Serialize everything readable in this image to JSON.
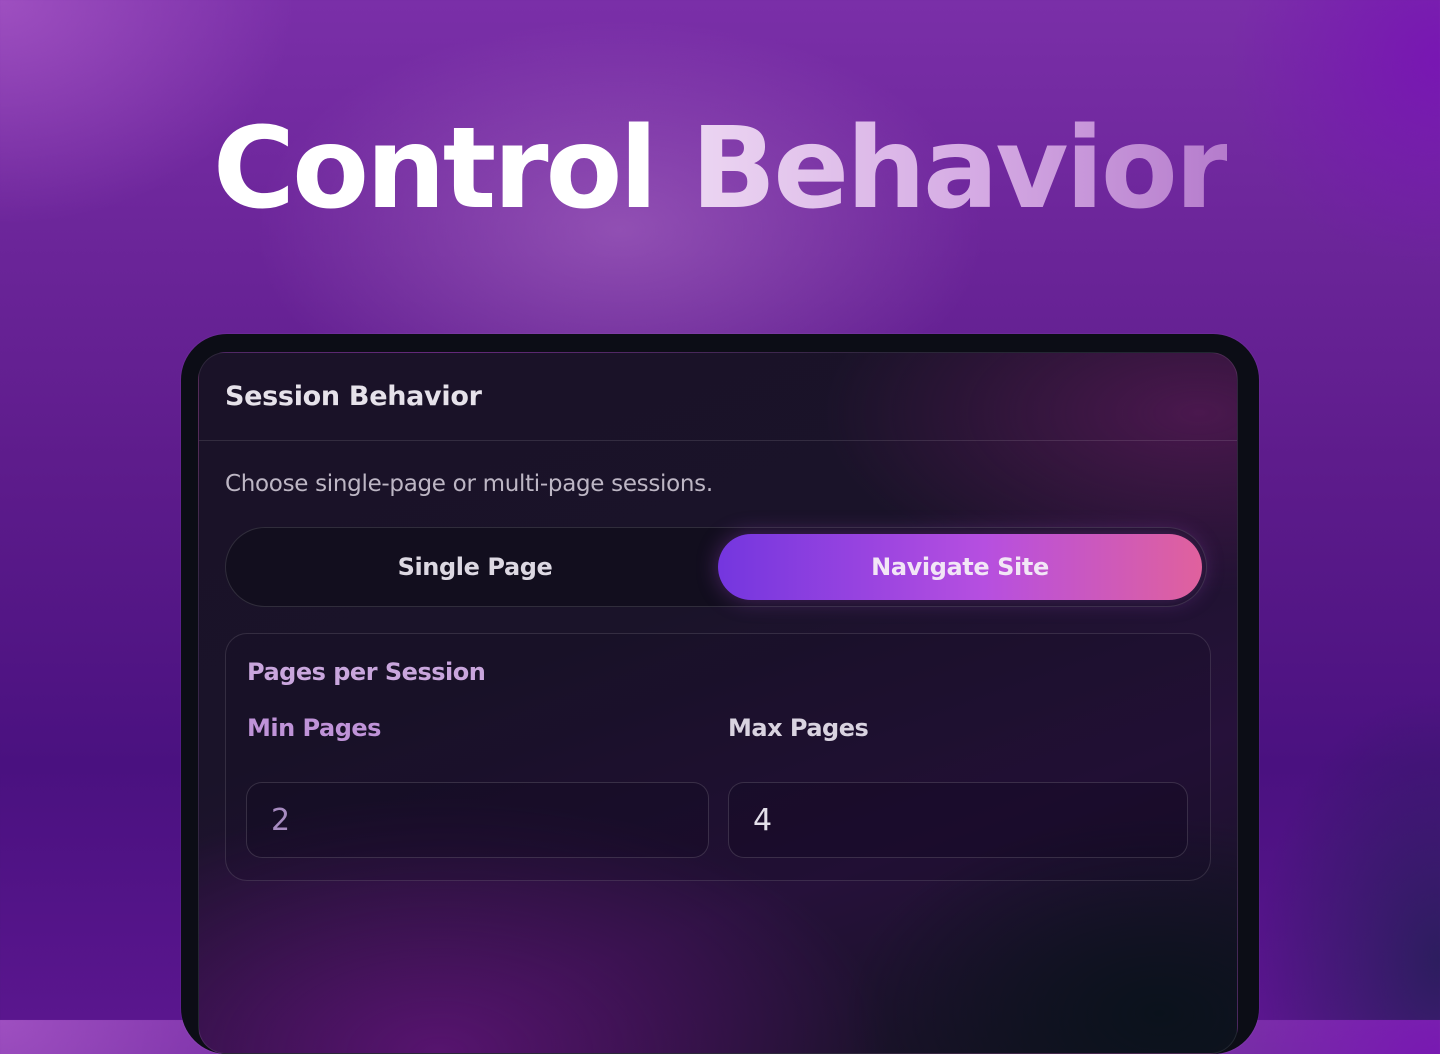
{
  "hero": {
    "title_word_1": "Control",
    "title_word_2": "Behavior"
  },
  "session_panel": {
    "title": "Session Behavior",
    "description": "Choose single-page or multi-page sessions.",
    "mode_toggle": {
      "options": [
        "Single Page",
        "Navigate Site"
      ],
      "selected": "Navigate Site"
    },
    "pages_card": {
      "title": "Pages per Session",
      "min_label": "Min Pages",
      "max_label": "Max Pages",
      "min_value": "2",
      "max_value": "4"
    }
  },
  "colors": {
    "accent_gradient_start": "#7436df",
    "accent_gradient_mid": "#b64fe0",
    "accent_gradient_end": "#e0619d",
    "background": "#5e1c8c"
  }
}
